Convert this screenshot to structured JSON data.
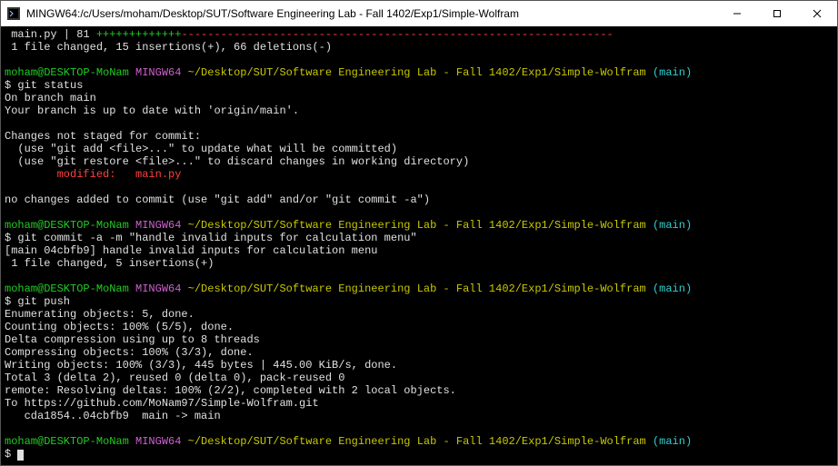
{
  "window": {
    "title": "MINGW64:/c/Users/moham/Desktop/SUT/Software Engineering Lab - Fall 1402/Exp1/Simple-Wolfram"
  },
  "colors": {
    "prompt_user": "#22cc22",
    "prompt_shell": "#d060d0",
    "prompt_path": "#c8c800",
    "prompt_branch": "#30d0d0",
    "diff_plus": "#22cc22",
    "diff_minus": "#ff4040",
    "modified": "#ff4040"
  },
  "prompt": {
    "user": "moham@DESKTOP-MoNam",
    "shell": "MINGW64",
    "path": "~/Desktop/SUT/Software Engineering Lab - Fall 1402/Exp1/Simple-Wolfram",
    "branch": "(main)"
  },
  "lines": {
    "diffstat_prefix": " main.py | 81 ",
    "diffstat_plus": "+++++++++++++",
    "diffstat_minus": "------------------------------------------------------------------",
    "diffstat_sum": " 1 file changed, 15 insertions(+), 66 deletions(-)",
    "blank": "",
    "cmd_status": "$ git status",
    "status_on_branch": "On branch main",
    "status_uptodate": "Your branch is up to date with 'origin/main'.",
    "status_not_staged": "Changes not staged for commit:",
    "status_hint_add": "  (use \"git add <file>...\" to update what will be committed)",
    "status_hint_restore": "  (use \"git restore <file>...\" to discard changes in working directory)",
    "status_modified_indent": "        ",
    "status_modified": "modified:   main.py",
    "status_no_changes": "no changes added to commit (use \"git add\" and/or \"git commit -a\")",
    "cmd_commit": "$ git commit -a -m \"handle invalid inputs for calculation menu\"",
    "commit_result": "[main 04cbfb9] handle invalid inputs for calculation menu",
    "commit_stat": " 1 file changed, 5 insertions(+)",
    "cmd_push": "$ git push",
    "push_enum": "Enumerating objects: 5, done.",
    "push_count": "Counting objects: 100% (5/5), done.",
    "push_delta": "Delta compression using up to 8 threads",
    "push_compress": "Compressing objects: 100% (3/3), done.",
    "push_write": "Writing objects: 100% (3/3), 445 bytes | 445.00 KiB/s, done.",
    "push_total": "Total 3 (delta 2), reused 0 (delta 0), pack-reused 0",
    "push_remote": "remote: Resolving deltas: 100% (2/2), completed with 2 local objects.",
    "push_to": "To https://github.com/MoNam97/Simple-Wolfram.git",
    "push_ref": "   cda1854..04cbfb9  main -> main",
    "final_prompt": "$ "
  }
}
